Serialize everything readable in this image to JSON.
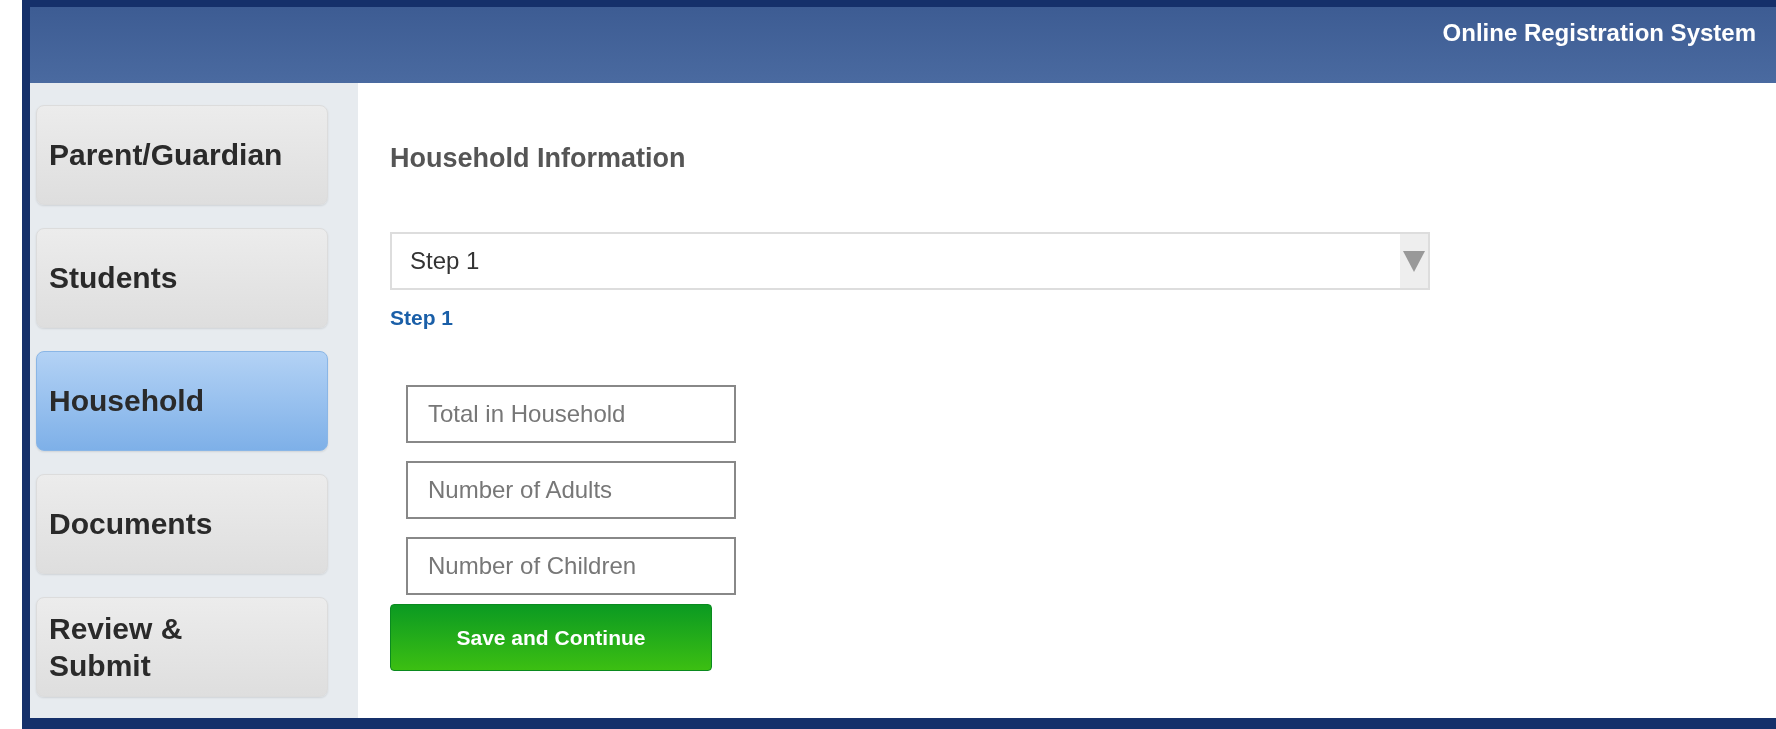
{
  "header": {
    "title": "Online Registration System"
  },
  "sidebar": {
    "items": [
      {
        "label": "Parent/Guardian",
        "selected": false
      },
      {
        "label": "Students",
        "selected": false
      },
      {
        "label": "Household",
        "selected": true
      },
      {
        "label": "Documents",
        "selected": false
      },
      {
        "label": "Review &\nSubmit",
        "selected": false
      }
    ]
  },
  "content": {
    "heading": "Household Information",
    "step_select": {
      "value": "Step 1"
    },
    "step_label": "Step 1",
    "fields": [
      {
        "placeholder": "Total in Household"
      },
      {
        "placeholder": "Number of Adults"
      },
      {
        "placeholder": "Number of Children"
      }
    ],
    "submit_button": "Save and Continue"
  }
}
